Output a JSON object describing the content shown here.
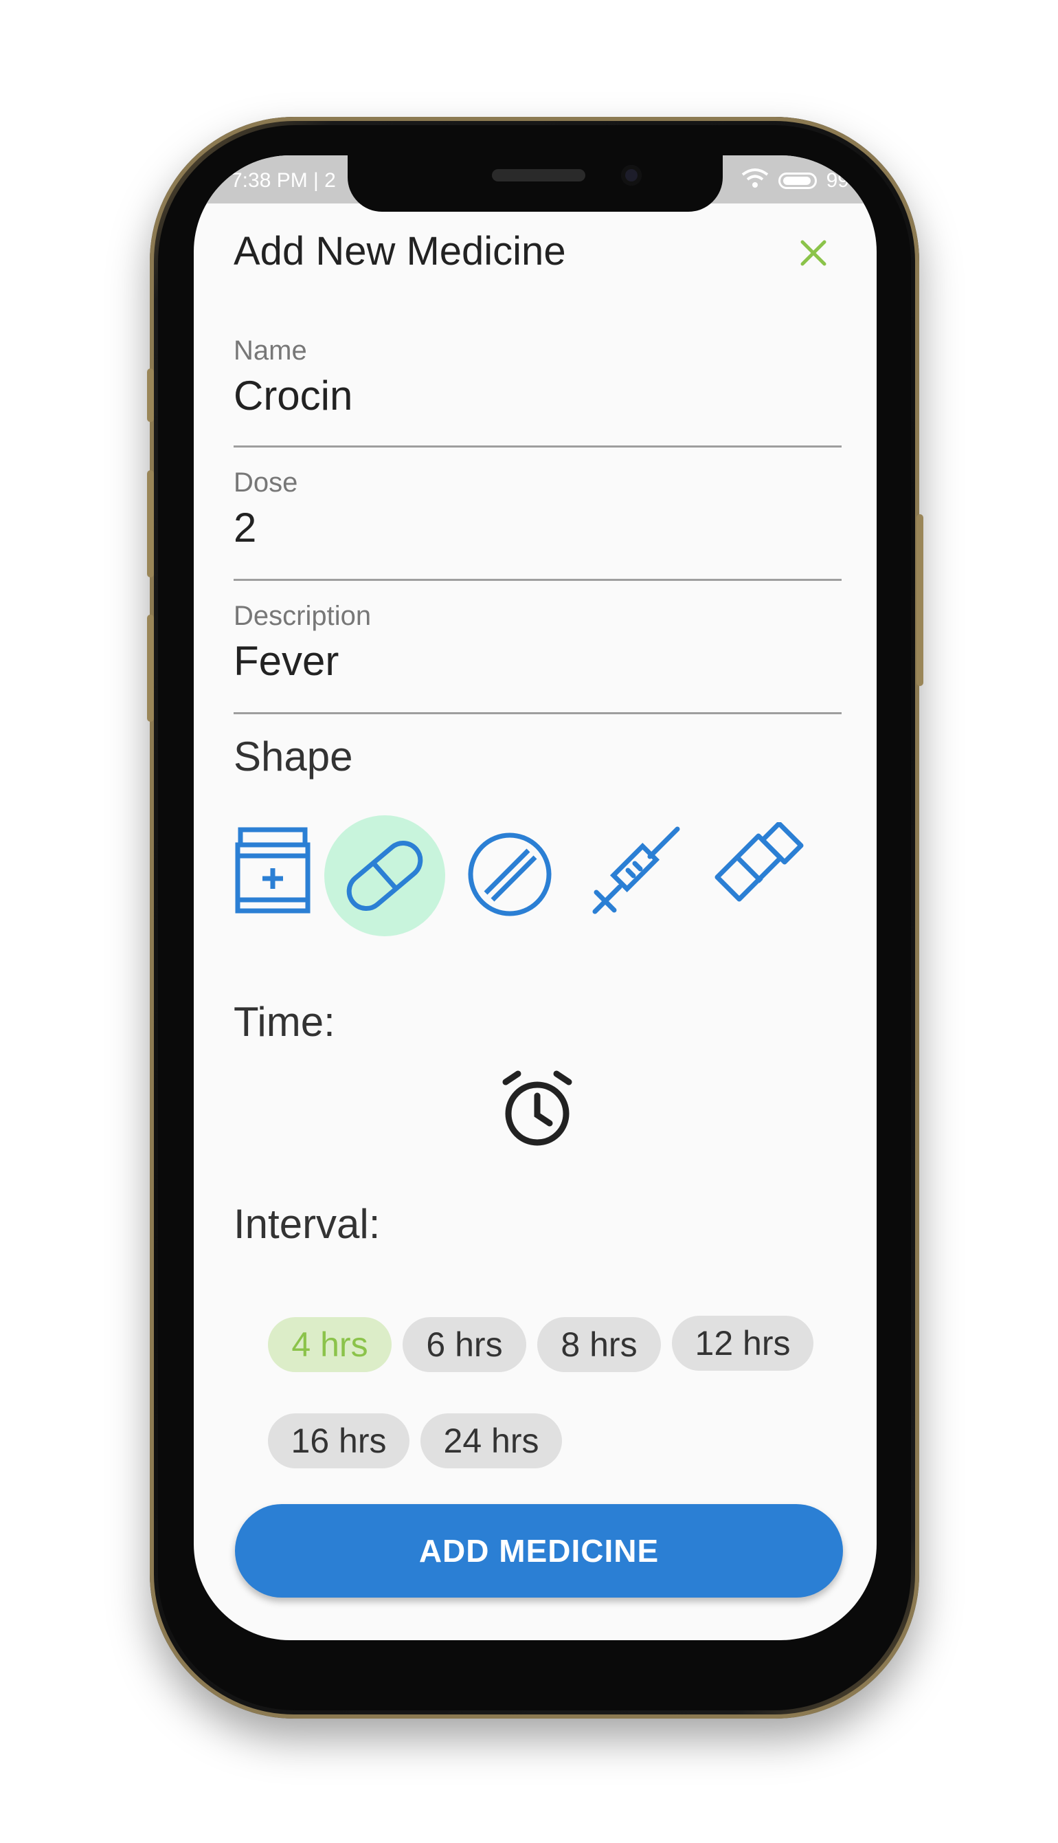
{
  "status_bar": {
    "time": "7:38 PM | 2",
    "battery": "99"
  },
  "dialog": {
    "title": "Add New Medicine",
    "close_icon": "close-icon"
  },
  "fields": {
    "name": {
      "label": "Name",
      "value": "Crocin"
    },
    "dose": {
      "label": "Dose",
      "value": "2"
    },
    "description": {
      "label": "Description",
      "value": "Fever"
    }
  },
  "shape": {
    "label": "Shape",
    "options": [
      {
        "icon": "bottle-icon",
        "selected": false
      },
      {
        "icon": "capsule-icon",
        "selected": true
      },
      {
        "icon": "tablet-icon",
        "selected": false
      },
      {
        "icon": "syringe-icon",
        "selected": false
      },
      {
        "icon": "ointment-tube-icon",
        "selected": false
      }
    ]
  },
  "time": {
    "label": "Time:",
    "icon": "alarm-clock-icon"
  },
  "interval": {
    "label": "Interval:",
    "options": [
      "4 hrs",
      "6 hrs",
      "8 hrs",
      "12 hrs",
      "16 hrs",
      "24 hrs"
    ],
    "selected": "4 hrs"
  },
  "submit_label": "ADD MEDICINE",
  "colors": {
    "accent_green": "#8bc34a",
    "primary_blue": "#2b7fd4",
    "icon_blue": "#2b7fd4",
    "selected_bg": "#c8f4dc"
  }
}
